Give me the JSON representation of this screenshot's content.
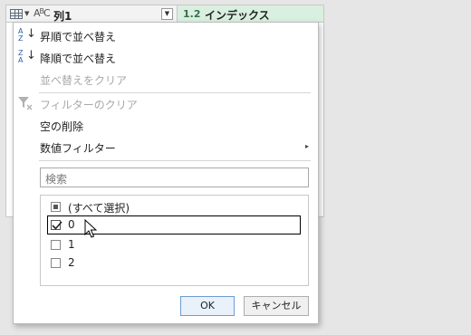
{
  "columns": [
    {
      "type_icon": "ABC",
      "name": "列1"
    },
    {
      "type_icon": "1.2",
      "name": "インデックス"
    }
  ],
  "menu": {
    "sort_asc": "昇順で並べ替え",
    "sort_desc": "降順で並べ替え",
    "clear_sort": "並べ替えをクリア",
    "clear_filter": "フィルターのクリア",
    "remove_empty": "空の削除",
    "number_filters": "数値フィルター"
  },
  "search": {
    "placeholder": "検索"
  },
  "values": [
    {
      "label": "(すべて選択)",
      "state": "partial"
    },
    {
      "label": "0",
      "state": "checked"
    },
    {
      "label": "1",
      "state": "unchecked"
    },
    {
      "label": "2",
      "state": "unchecked"
    }
  ],
  "buttons": {
    "ok": "OK",
    "cancel": "キャンセル"
  },
  "colors": {
    "header_selected": "#d9efe0",
    "accent": "#2e5fa3"
  }
}
